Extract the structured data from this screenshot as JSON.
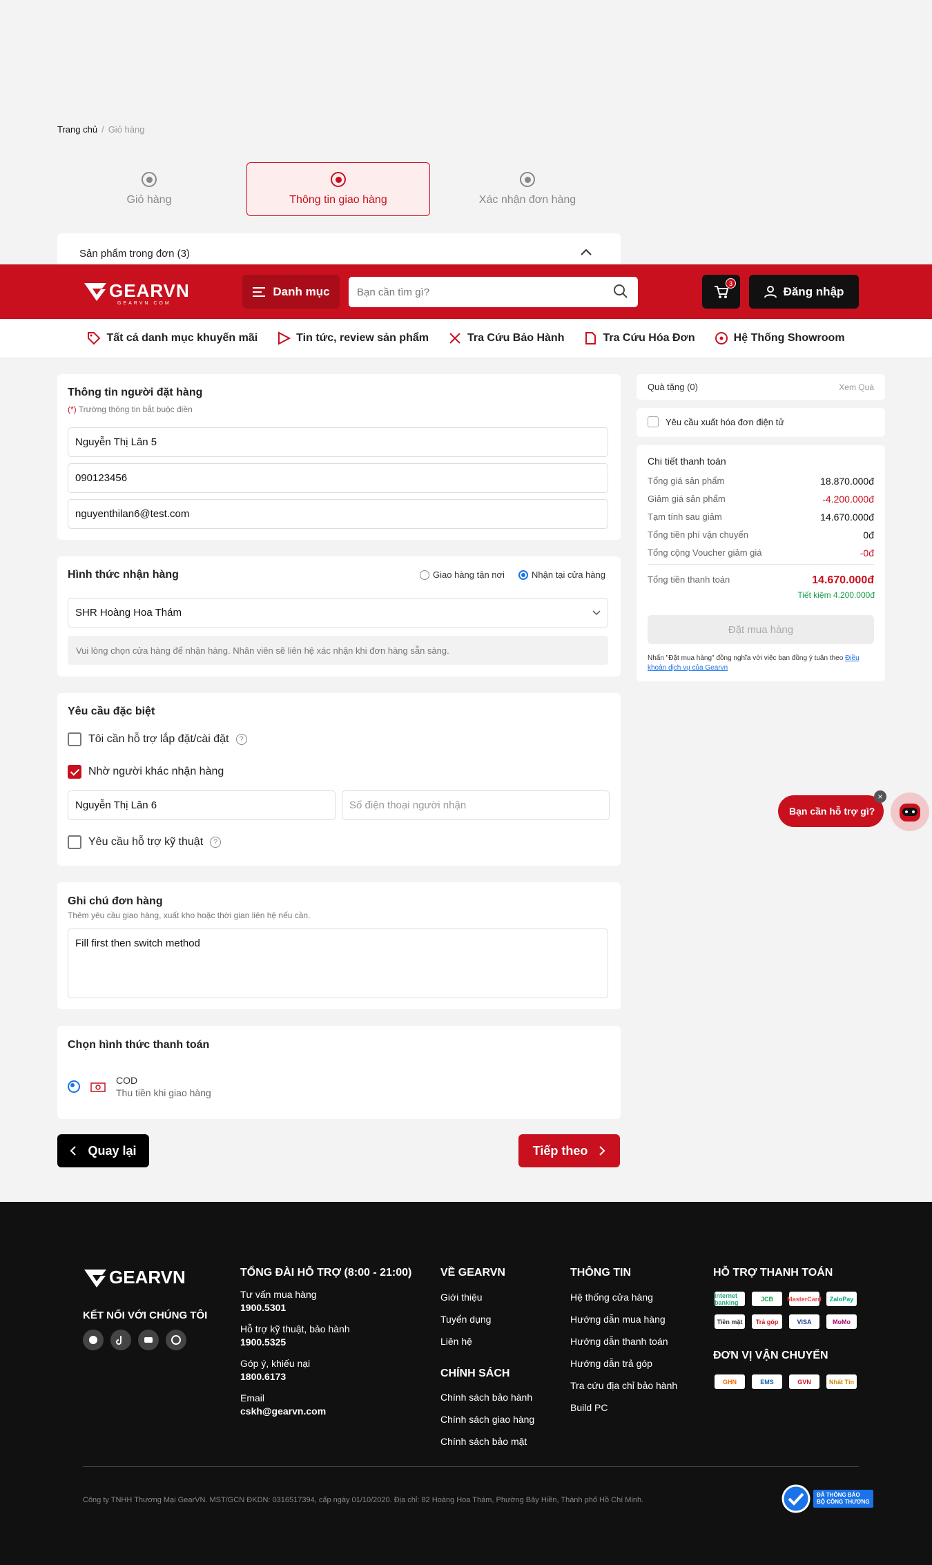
{
  "breadcrumb": {
    "home": "Trang chủ",
    "separator": "/",
    "current": "Giỏ hàng"
  },
  "steps": [
    {
      "label": "Giỏ hàng"
    },
    {
      "label": "Thông tin giao hàng"
    },
    {
      "label": "Xác nhận đơn hàng"
    }
  ],
  "products_section": {
    "title": "Sản phẩm trong đơn (3)"
  },
  "header": {
    "logo_text": "GEARVN",
    "logo_sub": "GEARVN.COM",
    "category_label": "Danh mục",
    "search_placeholder": "Bạn cần tìm gì?",
    "cart_count": "3",
    "login_label": "Đăng nhập"
  },
  "nav": [
    "Tất cả danh mục khuyến mãi",
    "Tin tức, review sản phẩm",
    "Tra Cứu Bảo Hành",
    "Tra Cứu Hóa Đơn",
    "Hệ Thống Showroom"
  ],
  "buyer": {
    "title": "Thông tin người đặt hàng",
    "required_mark": "(*)",
    "required_note": "Trường thông tin bắt buộc điền",
    "name": "Nguyễn Thị Lân 5",
    "phone": "090123456",
    "email": "nguyenthilan6@test.com"
  },
  "delivery": {
    "title": "Hình thức nhận hàng",
    "option_home": "Giao hàng tận nơi",
    "option_store": "Nhận tại cửa hàng",
    "selected": "Nhận tại cửa hàng",
    "store": "SHR Hoàng Hoa Thám",
    "note": "Vui lòng chọn cửa hàng để nhận hàng. Nhân viên sẽ liên hệ xác nhận khi đơn hàng sẵn sàng."
  },
  "special": {
    "title": "Yêu cầu đặc biệt",
    "install": "Tôi cần hỗ trợ lắp đặt/cài đặt",
    "install_checked": false,
    "other_receiver": "Nhờ người khác nhận hàng",
    "other_receiver_checked": true,
    "receiver_name": "Nguyễn Thị Lân 6",
    "receiver_phone_placeholder": "Số điện thoại người nhận",
    "tech": "Yêu cầu hỗ trợ kỹ thuật",
    "tech_checked": false,
    "help": "?"
  },
  "order_note": {
    "title": "Ghi chú đơn hàng",
    "subtitle": "Thêm yêu cầu giao hàng, xuất kho hoặc thời gian liên hệ nếu cần.",
    "value": "Fill first then switch method"
  },
  "payment": {
    "title": "Chọn hình thức thanh toán",
    "method": "COD",
    "method_desc": "Thu tiền khi giao hàng"
  },
  "actions": {
    "back": "Quay lại",
    "next": "Tiếp theo"
  },
  "gift": {
    "title": "Quà tặng (0)",
    "link": "Xem Quà"
  },
  "invoice": {
    "label": "Yêu cầu xuất hóa đơn điện tử"
  },
  "summary": {
    "title": "Chi tiết thanh toán",
    "rows": [
      {
        "label": "Tổng giá sản phẩm",
        "value": "18.870.000đ"
      },
      {
        "label": "Giảm giá sản phẩm",
        "value": "-4.200.000đ"
      },
      {
        "label": "Tạm tính sau giảm",
        "value": "14.670.000đ"
      },
      {
        "label": "Tổng tiền phí vận chuyển",
        "value": "0đ"
      },
      {
        "label": "Tổng cộng Voucher giảm giá",
        "value": "-0đ"
      }
    ],
    "total_label": "Tổng tiền thanh toán",
    "total": "14.670.000đ",
    "saving": "Tiết kiệm 4.200.000đ",
    "order_btn": "Đặt mua hàng",
    "terms_prefix": "Nhấn \"Đặt mua hàng\" đồng nghĩa với việc bạn đồng ý tuân theo ",
    "terms_link": "Điều khoản dịch vụ của Gearvn"
  },
  "chat": {
    "label": "Bạn cần hỗ trợ gì?",
    "close": "×"
  },
  "footer": {
    "connect": "KẾT NỐI VỚI CHÚNG TÔI",
    "hotline_title": "TỔNG ĐÀI HỖ TRỢ (8:00 - 21:00)",
    "hotlines": [
      {
        "label": "Tư vấn mua hàng",
        "value": "1900.5301"
      },
      {
        "label": "Hỗ trợ kỹ thuật, bảo hành",
        "value": "1900.5325"
      },
      {
        "label": "Góp ý, khiếu nại",
        "value": "1800.6173"
      },
      {
        "label": "Email",
        "value": "cskh@gearvn.com"
      }
    ],
    "about_title": "VỀ GEARVN",
    "about": [
      "Giới thiệu",
      "Tuyển dụng",
      "Liên hệ"
    ],
    "policy_title": "CHÍNH SÁCH",
    "policy": [
      "Chính sách bảo hành",
      "Chính sách giao hàng",
      "Chính sách bảo mật"
    ],
    "info_title": "THÔNG TIN",
    "info": [
      "Hệ thống cửa hàng",
      "Hướng dẫn mua hàng",
      "Hướng dẫn thanh toán",
      "Hướng dẫn trả góp",
      "Tra cứu địa chỉ bảo hành",
      "Build PC"
    ],
    "payment_title": "HỖ TRỢ THANH TOÁN",
    "payments": [
      "internet banking",
      "JCB",
      "MasterCard",
      "ZaloPay",
      "Tiền mặt",
      "Trả góp",
      "VISA",
      "MoMo"
    ],
    "shipping_title": "ĐƠN VỊ VẬN CHUYỂN",
    "shippers": [
      "GHN",
      "EMS",
      "GVN",
      "Nhất Tín"
    ],
    "company": "Công ty TNHH Thương Mại GearVN. MST/GCN ĐKDN: 0316517394, cấp ngày 01/10/2020. Địa chỉ: 82 Hoàng Hoa Thám, Phường Bảy Hiền, Thành phố Hồ Chí Minh.",
    "badge_line1": "ĐÃ THÔNG BÁO",
    "badge_line2": "BỘ CÔNG THƯƠNG"
  }
}
